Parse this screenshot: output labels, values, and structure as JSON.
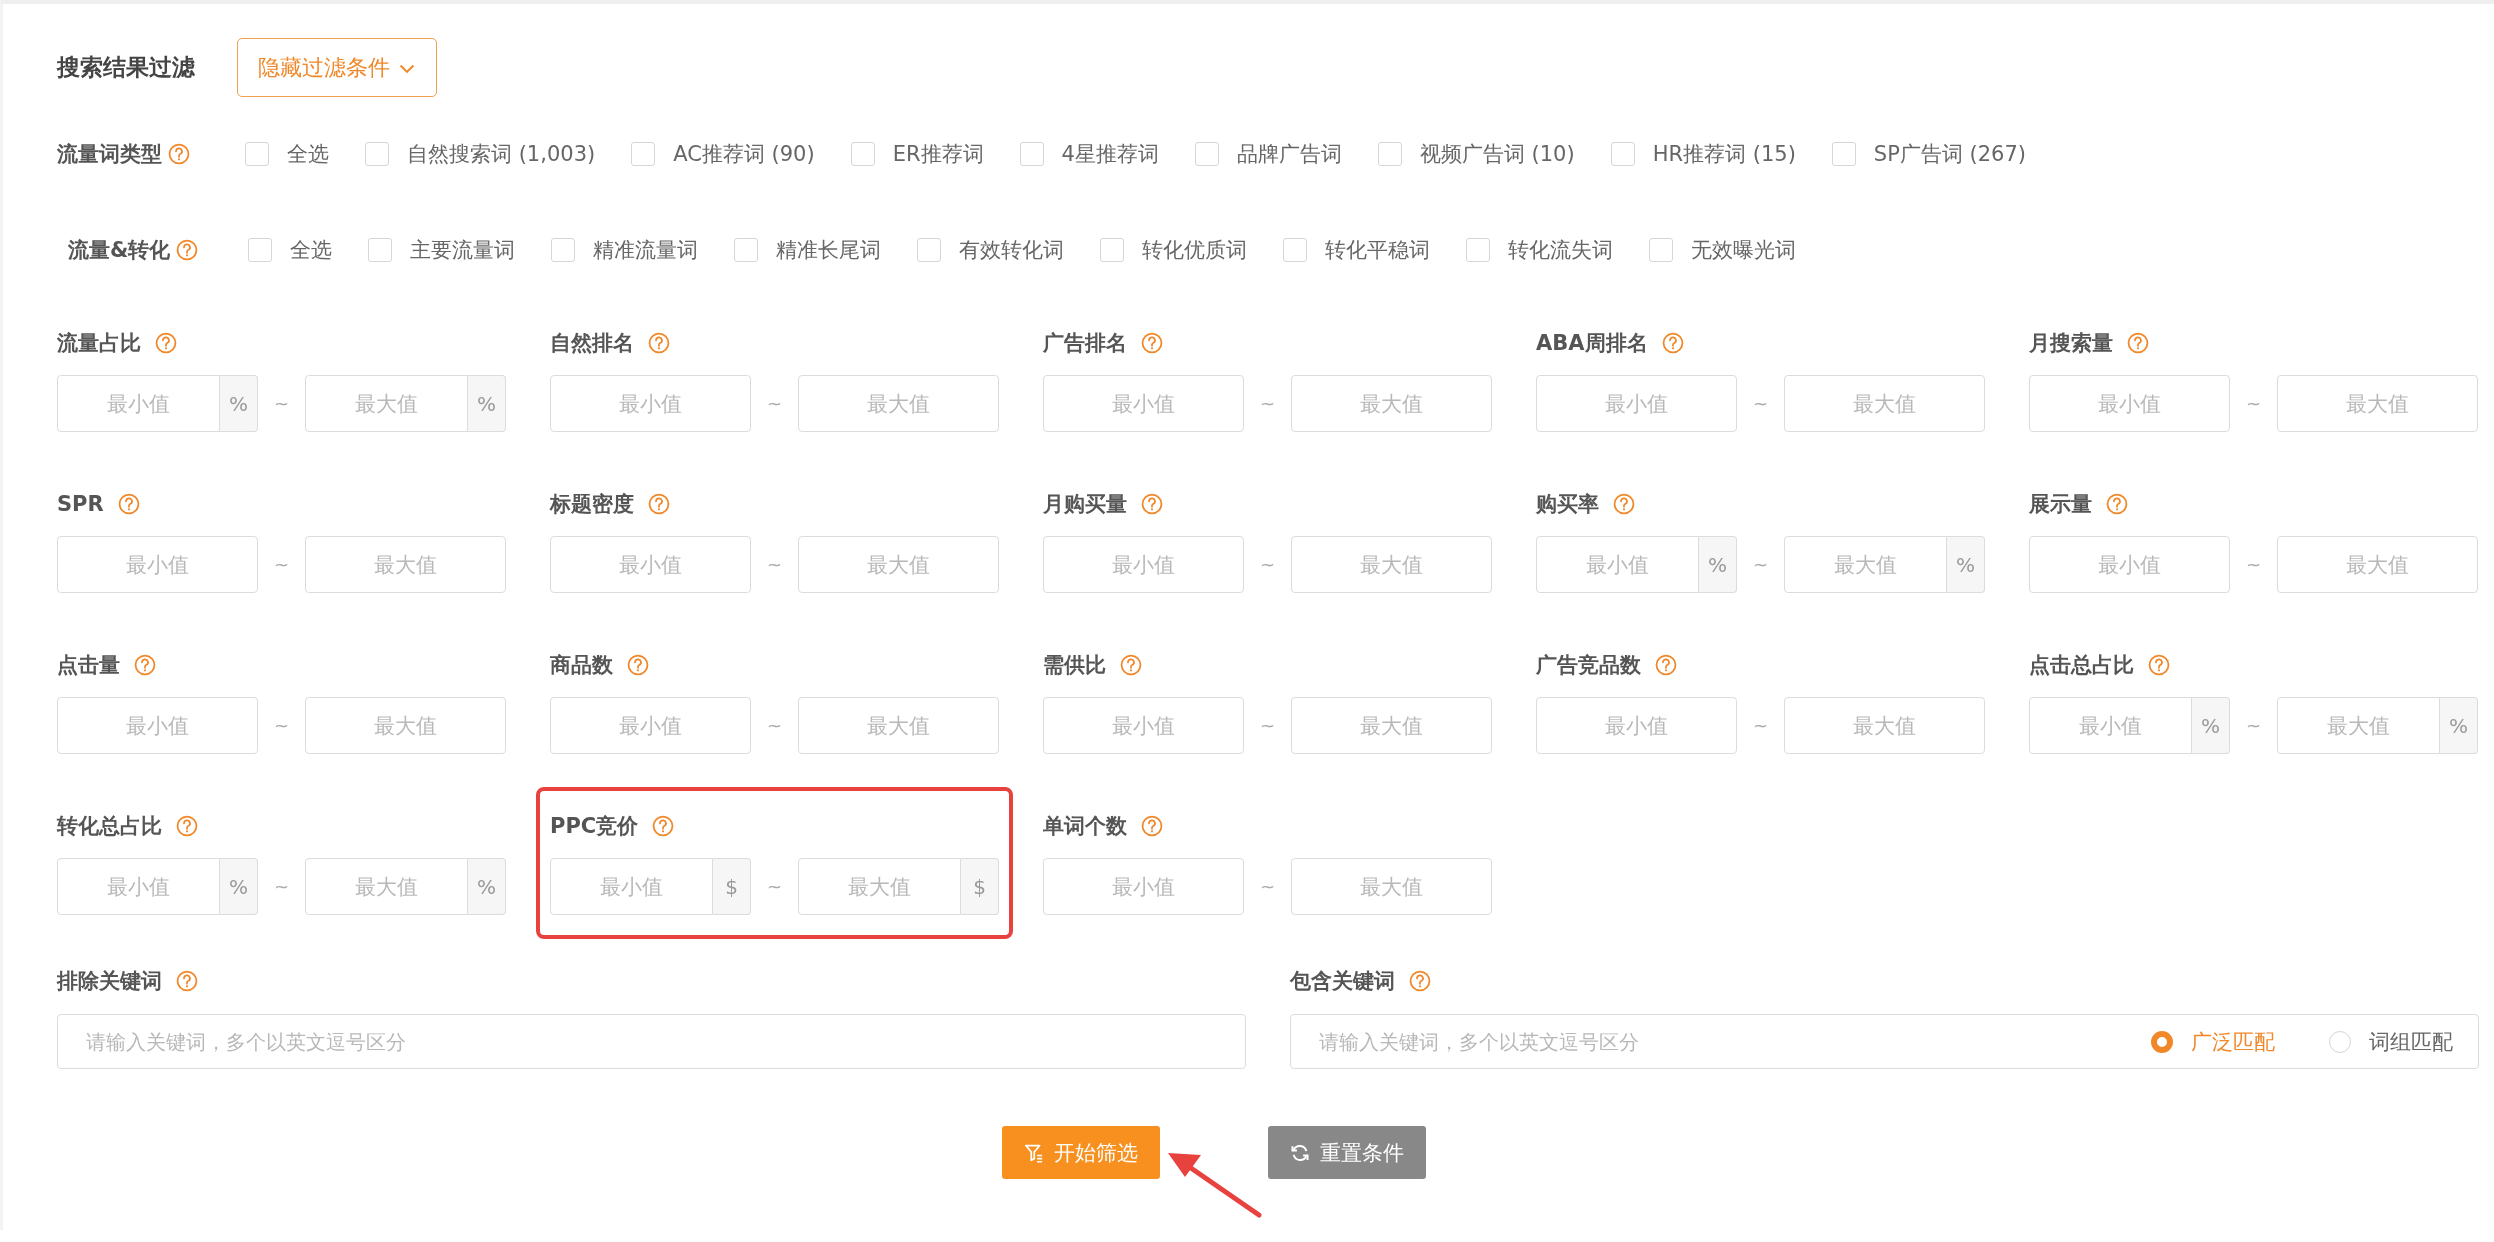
{
  "section_title": "搜索结果过滤",
  "toggle_button": {
    "label": "隐藏过滤条件",
    "expanded": true
  },
  "checkbox_groups": [
    {
      "label": "流量词类型",
      "options": [
        {
          "label": "全选",
          "checked": false
        },
        {
          "label": "自然搜索词 (1,003)",
          "checked": false
        },
        {
          "label": "AC推荐词 (90)",
          "checked": false
        },
        {
          "label": "ER推荐词",
          "checked": false
        },
        {
          "label": "4星推荐词",
          "checked": false
        },
        {
          "label": "品牌广告词",
          "checked": false
        },
        {
          "label": "视频广告词 (10)",
          "checked": false
        },
        {
          "label": "HR推荐词 (15)",
          "checked": false
        },
        {
          "label": "SP广告词 (267)",
          "checked": false
        }
      ]
    },
    {
      "label": "流量&转化",
      "options": [
        {
          "label": "全选",
          "checked": false
        },
        {
          "label": "主要流量词",
          "checked": false
        },
        {
          "label": "精准流量词",
          "checked": false
        },
        {
          "label": "精准长尾词",
          "checked": false
        },
        {
          "label": "有效转化词",
          "checked": false
        },
        {
          "label": "转化优质词",
          "checked": false
        },
        {
          "label": "转化平稳词",
          "checked": false
        },
        {
          "label": "转化流失词",
          "checked": false
        },
        {
          "label": "无效曝光词",
          "checked": false
        }
      ]
    }
  ],
  "range_fields": [
    {
      "label": "流量占比",
      "min_placeholder": "最小值",
      "max_placeholder": "最大值",
      "separator": "~",
      "unit_min": "%",
      "unit_max": "%",
      "highlighted": false
    },
    {
      "label": "自然排名",
      "min_placeholder": "最小值",
      "max_placeholder": "最大值",
      "separator": "~",
      "highlighted": false
    },
    {
      "label": "广告排名",
      "min_placeholder": "最小值",
      "max_placeholder": "最大值",
      "separator": "~",
      "highlighted": false
    },
    {
      "label": "ABA周排名",
      "min_placeholder": "最小值",
      "max_placeholder": "最大值",
      "separator": "~",
      "highlighted": false
    },
    {
      "label": "月搜索量",
      "min_placeholder": "最小值",
      "max_placeholder": "最大值",
      "separator": "~",
      "highlighted": false
    },
    {
      "label": "SPR",
      "min_placeholder": "最小值",
      "max_placeholder": "最大值",
      "separator": "~",
      "highlighted": false
    },
    {
      "label": "标题密度",
      "min_placeholder": "最小值",
      "max_placeholder": "最大值",
      "separator": "~",
      "highlighted": false
    },
    {
      "label": "月购买量",
      "min_placeholder": "最小值",
      "max_placeholder": "最大值",
      "separator": "~",
      "highlighted": false
    },
    {
      "label": "购买率",
      "min_placeholder": "最小值",
      "max_placeholder": "最大值",
      "separator": "~",
      "unit_min": "%",
      "unit_max": "%",
      "highlighted": false
    },
    {
      "label": "展示量",
      "min_placeholder": "最小值",
      "max_placeholder": "最大值",
      "separator": "~",
      "highlighted": false
    },
    {
      "label": "点击量",
      "min_placeholder": "最小值",
      "max_placeholder": "最大值",
      "separator": "~",
      "highlighted": false
    },
    {
      "label": "商品数",
      "min_placeholder": "最小值",
      "max_placeholder": "最大值",
      "separator": "~",
      "highlighted": false
    },
    {
      "label": "需供比",
      "min_placeholder": "最小值",
      "max_placeholder": "最大值",
      "separator": "~",
      "highlighted": false
    },
    {
      "label": "广告竞品数",
      "min_placeholder": "最小值",
      "max_placeholder": "最大值",
      "separator": "~",
      "highlighted": false
    },
    {
      "label": "点击总占比",
      "min_placeholder": "最小值",
      "max_placeholder": "最大值",
      "separator": "~",
      "unit_min": "%",
      "unit_max": "%",
      "highlighted": false
    },
    {
      "label": "转化总占比",
      "min_placeholder": "最小值",
      "max_placeholder": "最大值",
      "separator": "~",
      "unit_min": "%",
      "unit_max": "%",
      "highlighted": false
    },
    {
      "label": "PPC竞价",
      "min_placeholder": "最小值",
      "max_placeholder": "最大值",
      "separator": "~",
      "unit_min": "$",
      "unit_max": "$",
      "highlighted": true
    },
    {
      "label": "单词个数",
      "min_placeholder": "最小值",
      "max_placeholder": "最大值",
      "separator": "~",
      "highlighted": false
    }
  ],
  "keyword_fields": [
    {
      "label": "排除关键词",
      "placeholder": "请输入关键词，多个以英文逗号区分"
    },
    {
      "label": "包含关键词",
      "placeholder": "请输入关键词，多个以英文逗号区分",
      "match_options": [
        {
          "label": "广泛匹配",
          "selected": true
        },
        {
          "label": "词组匹配",
          "selected": false
        }
      ]
    }
  ],
  "buttons": [
    {
      "kind": "primary",
      "label": "开始筛选",
      "pointed": true
    },
    {
      "kind": "reset",
      "label": "重置条件",
      "pointed": false
    }
  ]
}
